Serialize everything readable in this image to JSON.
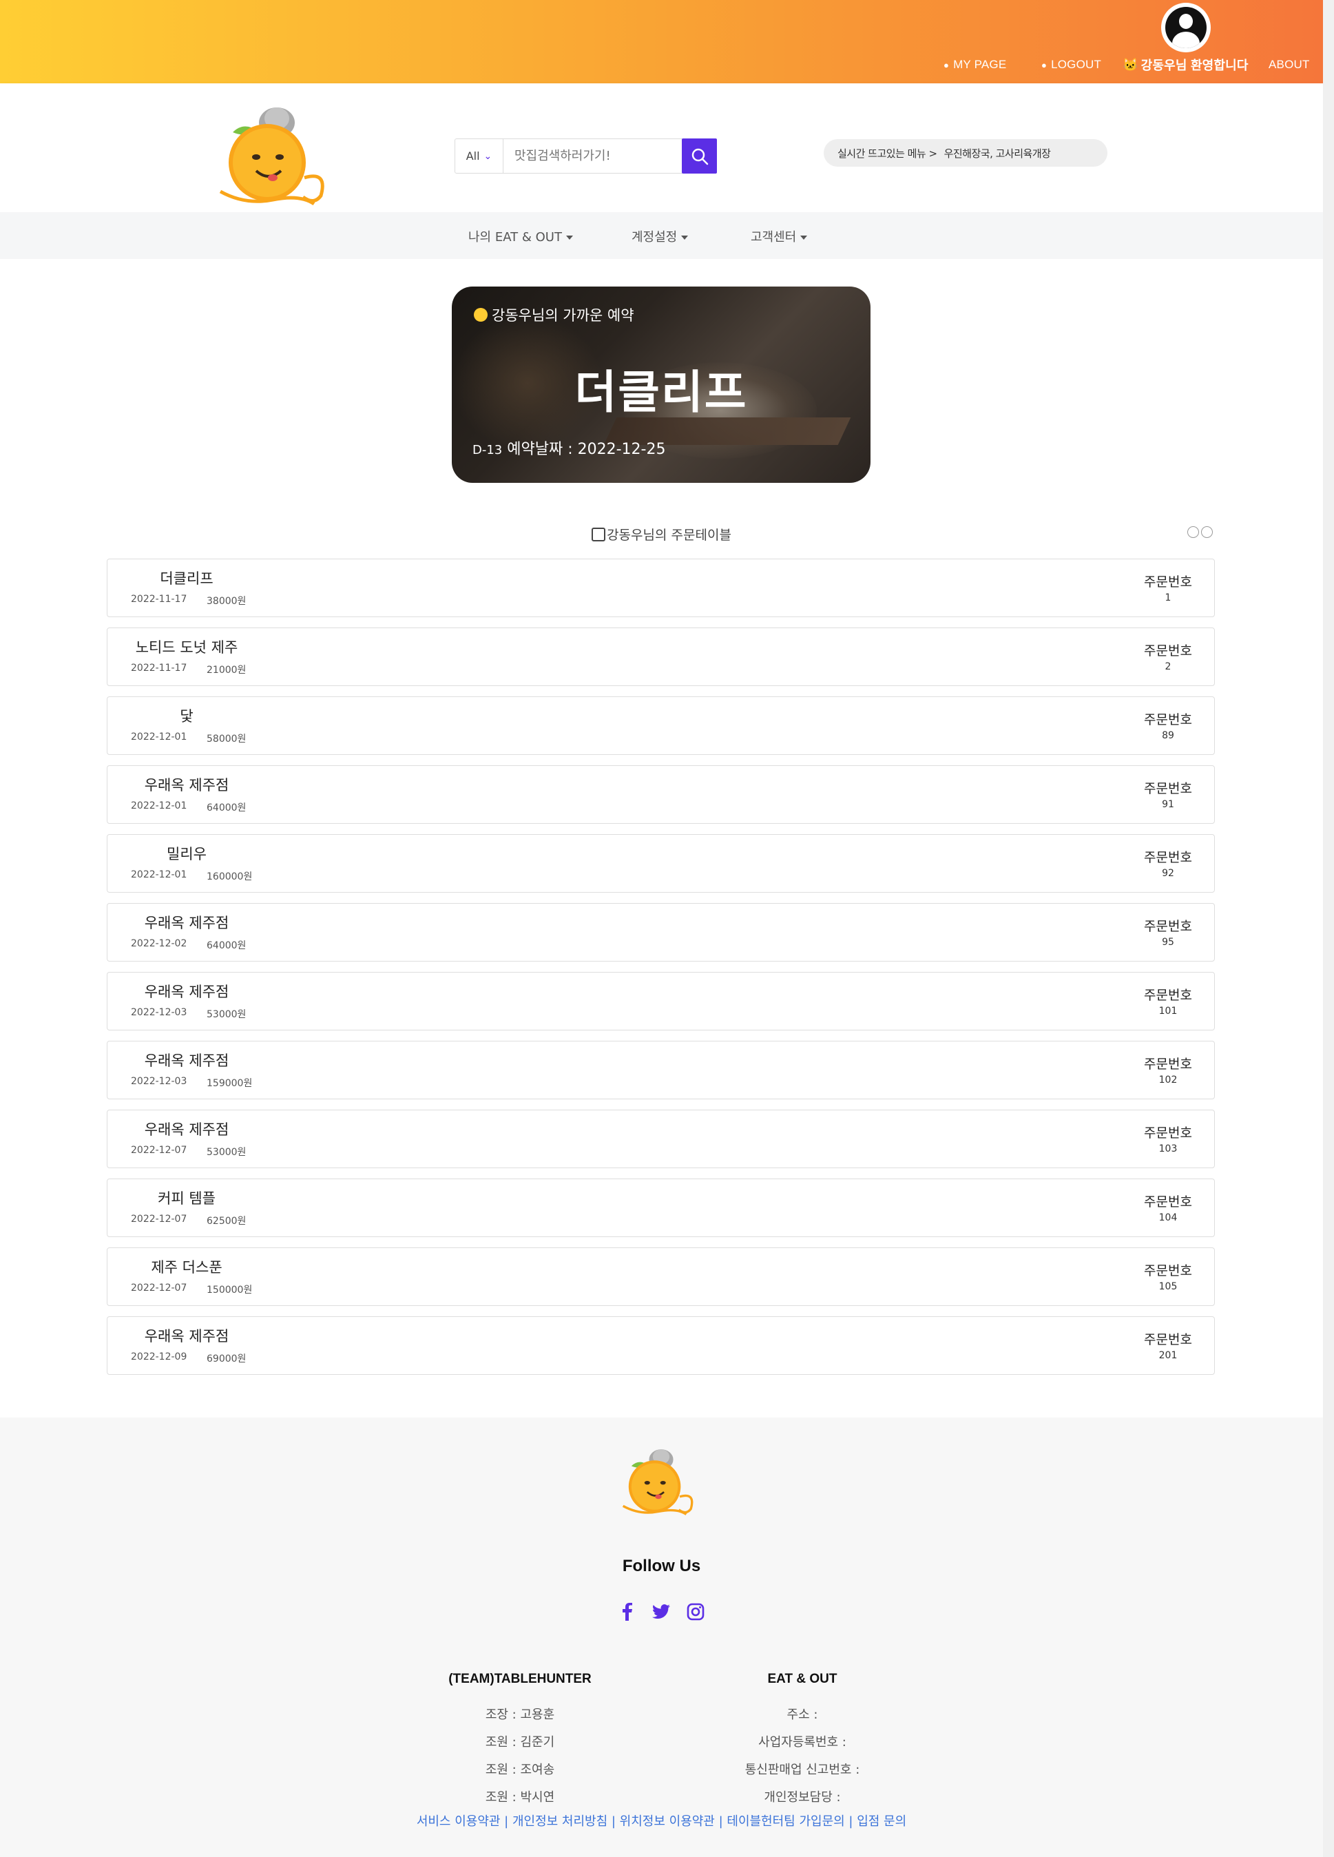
{
  "topbar": {
    "mypage": "MY PAGE",
    "logout": "LOGOUT",
    "welcome": "강동우님 환영합니다",
    "about": "ABOUT"
  },
  "search": {
    "category": "All",
    "placeholder": "맛집검색하러가기!"
  },
  "trending": {
    "label": "실시간 뜨고있는 메뉴 >",
    "items": "우진해장국, 고사리육개장"
  },
  "subnav": {
    "items": [
      {
        "label": "나의 EAT & OUT"
      },
      {
        "label": "계정설정"
      },
      {
        "label": "고객센터"
      }
    ]
  },
  "reservation": {
    "subtitle": "강동우님의 가까운 예약",
    "restaurant": "더클리프",
    "dday": "D-13",
    "date_text": "예약날짜 : 2022-12-25"
  },
  "orders": {
    "title": "강동우님의 주문테이블",
    "order_label": "주문번호",
    "items": [
      {
        "name": "더클리프",
        "date": "2022-11-17",
        "price": "38000원",
        "number": "1"
      },
      {
        "name": "노티드 도넛 제주",
        "date": "2022-11-17",
        "price": "21000원",
        "number": "2"
      },
      {
        "name": "닻",
        "date": "2022-12-01",
        "price": "58000원",
        "number": "89"
      },
      {
        "name": "우래옥 제주점",
        "date": "2022-12-01",
        "price": "64000원",
        "number": "91"
      },
      {
        "name": "밀리우",
        "date": "2022-12-01",
        "price": "160000원",
        "number": "92"
      },
      {
        "name": "우래옥 제주점",
        "date": "2022-12-02",
        "price": "64000원",
        "number": "95"
      },
      {
        "name": "우래옥 제주점",
        "date": "2022-12-03",
        "price": "53000원",
        "number": "101"
      },
      {
        "name": "우래옥 제주점",
        "date": "2022-12-03",
        "price": "159000원",
        "number": "102"
      },
      {
        "name": "우래옥 제주점",
        "date": "2022-12-07",
        "price": "53000원",
        "number": "103"
      },
      {
        "name": "커피 템플",
        "date": "2022-12-07",
        "price": "62500원",
        "number": "104"
      },
      {
        "name": "제주 더스푼",
        "date": "2022-12-07",
        "price": "150000원",
        "number": "105"
      },
      {
        "name": "우래옥 제주점",
        "date": "2022-12-09",
        "price": "69000원",
        "number": "201"
      }
    ]
  },
  "footer": {
    "follow": "Follow Us",
    "social_icons": [
      "facebook-icon",
      "twitter-icon",
      "instagram-icon"
    ],
    "team_title": "(TEAM)TABLEHUNTER",
    "team_members": [
      "조장 : 고용훈",
      "조원 : 김준기",
      "조원 : 조여송",
      "조원 : 박시연"
    ],
    "company_title": "EAT & OUT",
    "company_info": [
      "주소 :",
      "사업자등록번호 :",
      "통신판매업 신고번호 :",
      "개인정보담당 :"
    ],
    "links": "서비스 이용약관 | 개인정보 처리방침 | 위치정보 이용약관 | 테이블헌터팀 가입문의 | 입점 문의"
  },
  "colors": {
    "accent": "#5b2ee5",
    "gradient_start": "#ffce34",
    "gradient_end": "#f5763a",
    "link": "#3b73d9"
  }
}
